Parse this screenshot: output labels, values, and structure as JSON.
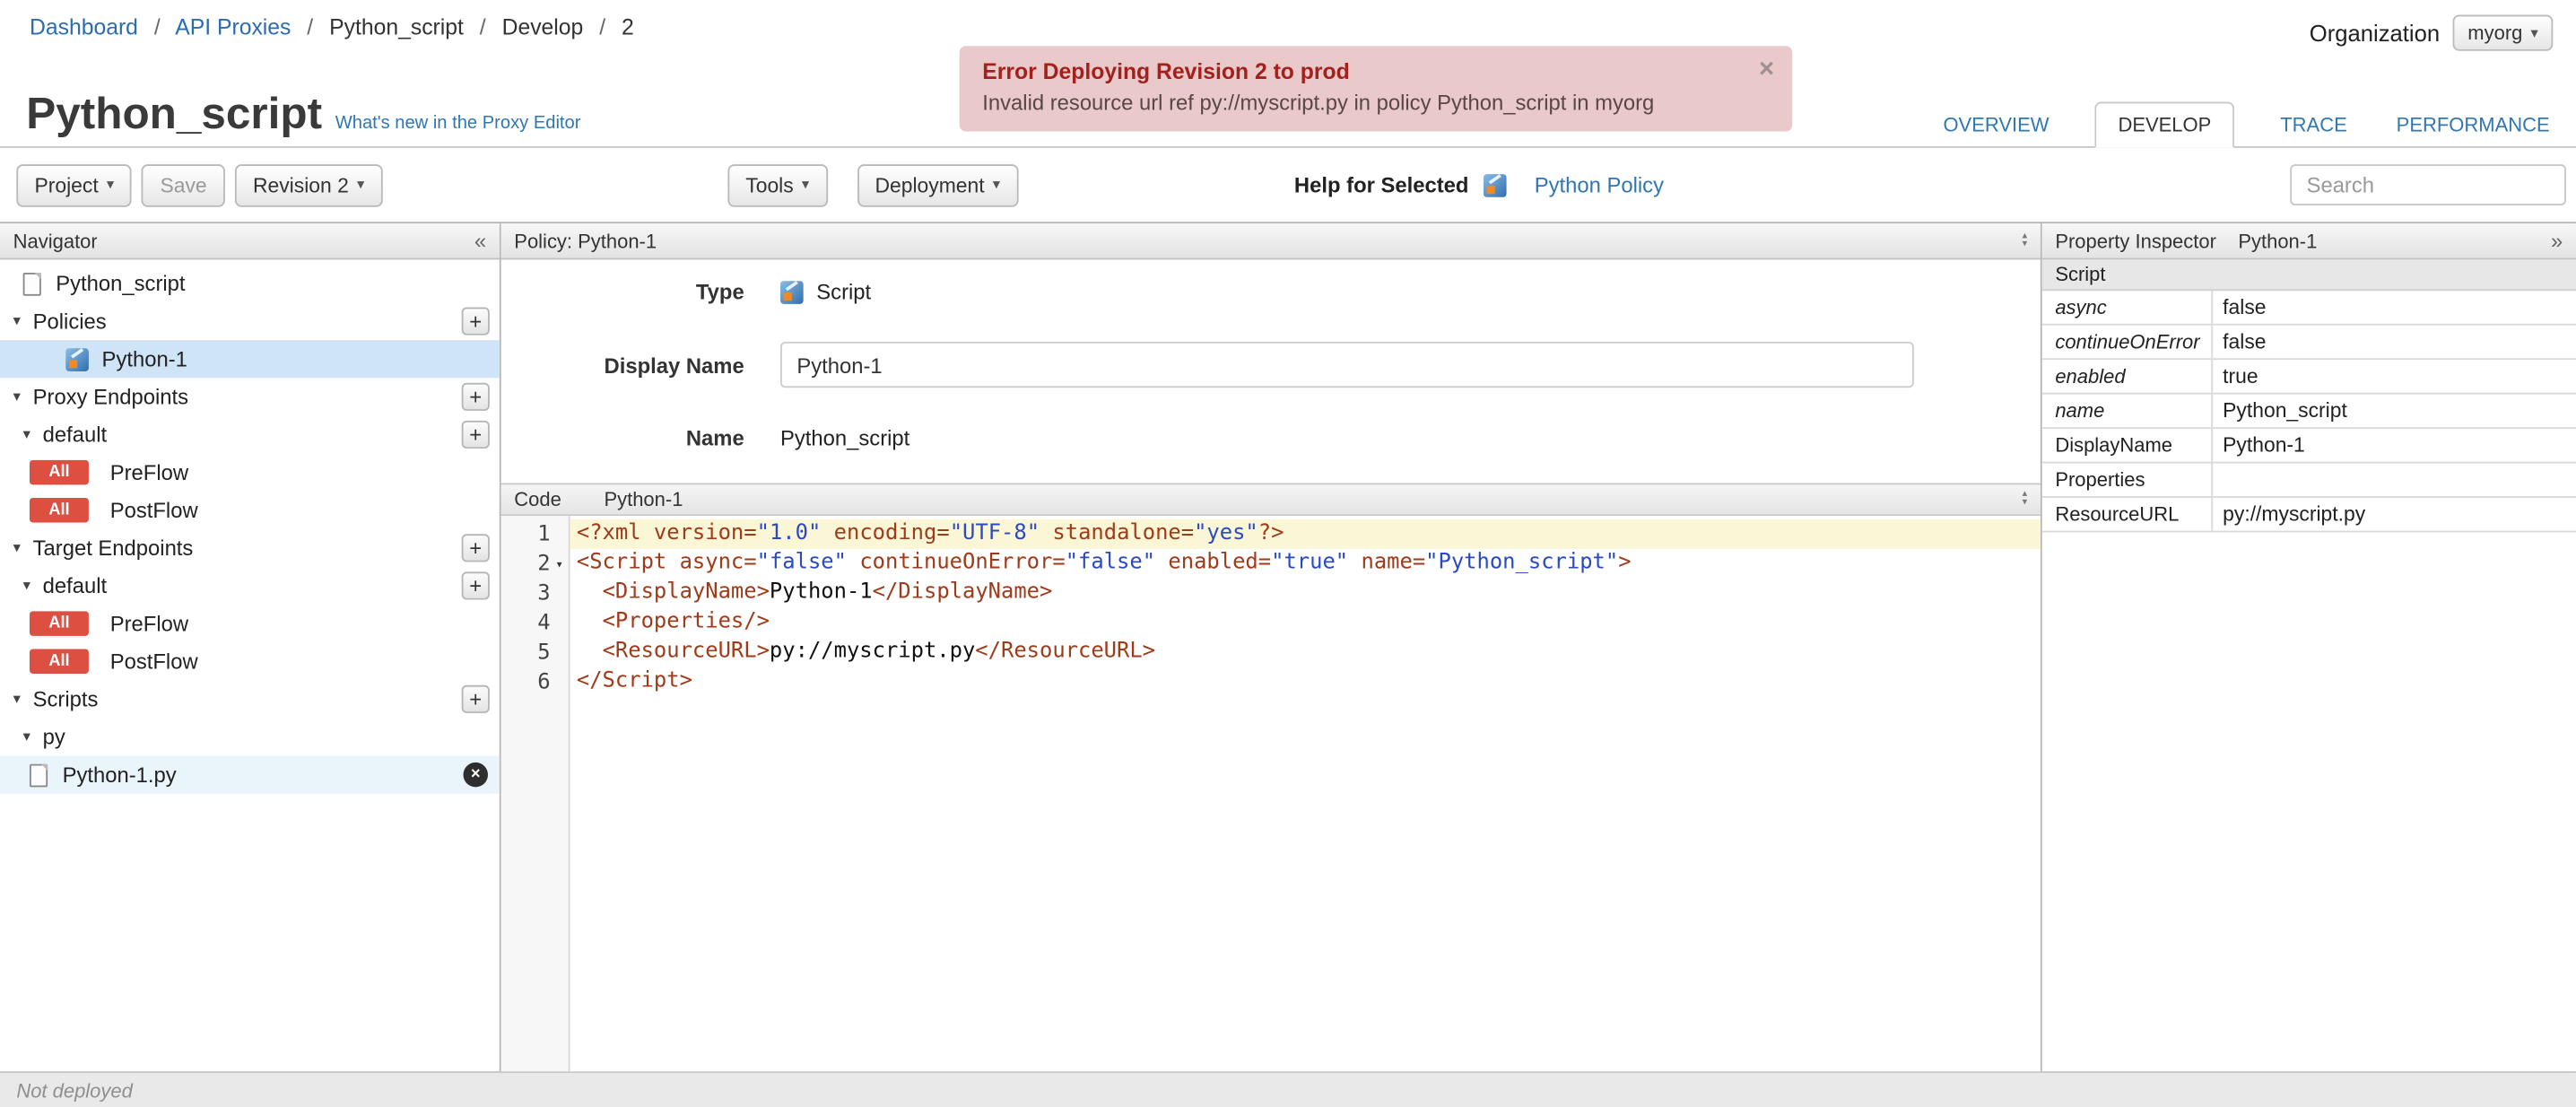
{
  "icons": {
    "caret_down": "▾",
    "collapse_left": "«",
    "expand_right": "»",
    "close": "×",
    "plus": "+",
    "tree_expanded": "▾",
    "sort_up": "▴",
    "sort_down": "▾",
    "fold_down": "▾",
    "delete_x": "×"
  },
  "colors": {
    "accent_blue": "#3077b4",
    "error_bg": "#e9c9c9",
    "error_title": "#a3201d",
    "badge_red": "#dc4f41",
    "selection_blue": "#cfe4f6",
    "active_line_yellow": "#fbf6d5"
  },
  "breadcrumb": {
    "separator": "/",
    "items": [
      {
        "label": "Dashboard",
        "link": true
      },
      {
        "label": "API Proxies",
        "link": true
      },
      {
        "label": "Python_script",
        "link": false
      },
      {
        "label": "Develop",
        "link": false
      },
      {
        "label": "2",
        "link": false
      }
    ]
  },
  "organization": {
    "label": "Organization",
    "value": "myorg"
  },
  "alert": {
    "title": "Error Deploying Revision 2 to prod",
    "message": "Invalid resource url ref py://myscript.py in policy Python_script in myorg"
  },
  "page": {
    "title": "Python_script",
    "whats_new_link": "What's new in the Proxy Editor"
  },
  "tabs": [
    {
      "label": "OVERVIEW"
    },
    {
      "label": "DEVELOP"
    },
    {
      "label": "TRACE"
    },
    {
      "label": "PERFORMANCE"
    }
  ],
  "toolbar": {
    "project": "Project",
    "save": "Save",
    "revision": "Revision 2",
    "tools": "Tools",
    "deployment": "Deployment",
    "help_label": "Help for Selected",
    "help_link": "Python Policy",
    "search_placeholder": "Search"
  },
  "navigator": {
    "title": "Navigator",
    "root": {
      "label": "Python_script"
    },
    "sections": {
      "policies": {
        "label": "Policies",
        "items": [
          {
            "label": "Python-1",
            "selected": true
          }
        ]
      },
      "proxy_endpoints": {
        "label": "Proxy Endpoints",
        "groups": [
          {
            "label": "default",
            "flows": [
              {
                "badge": "All",
                "label": "PreFlow"
              },
              {
                "badge": "All",
                "label": "PostFlow"
              }
            ]
          }
        ]
      },
      "target_endpoints": {
        "label": "Target Endpoints",
        "groups": [
          {
            "label": "default",
            "flows": [
              {
                "badge": "All",
                "label": "PreFlow"
              },
              {
                "badge": "All",
                "label": "PostFlow"
              }
            ]
          }
        ]
      },
      "scripts": {
        "label": "Scripts",
        "groups": [
          {
            "label": "py",
            "files": [
              {
                "label": "Python-1.py"
              }
            ]
          }
        ]
      }
    }
  },
  "policy_panel": {
    "title": "Policy: Python-1",
    "type_label": "Type",
    "type_value": "Script",
    "display_name_label": "Display Name",
    "display_name_value": "Python-1",
    "name_label": "Name",
    "name_value": "Python_script"
  },
  "code_panel": {
    "label": "Code",
    "name": "Python-1",
    "lines": [
      {
        "n": 1,
        "active": true,
        "fold": false,
        "tokens": [
          [
            "tag",
            "<?xml "
          ],
          [
            "attr",
            "version="
          ],
          [
            "val",
            "\"1.0\""
          ],
          [
            "pln",
            " "
          ],
          [
            "attr",
            "encoding="
          ],
          [
            "val",
            "\"UTF-8\""
          ],
          [
            "pln",
            " "
          ],
          [
            "attr",
            "standalone="
          ],
          [
            "val",
            "\"yes\""
          ],
          [
            "tag",
            "?>"
          ]
        ]
      },
      {
        "n": 2,
        "active": false,
        "fold": true,
        "tokens": [
          [
            "tag",
            "<Script "
          ],
          [
            "attr",
            "async="
          ],
          [
            "val",
            "\"false\""
          ],
          [
            "pln",
            " "
          ],
          [
            "attr",
            "continueOnError="
          ],
          [
            "val",
            "\"false\""
          ],
          [
            "pln",
            " "
          ],
          [
            "attr",
            "enabled="
          ],
          [
            "val",
            "\"true\""
          ],
          [
            "pln",
            " "
          ],
          [
            "attr",
            "name="
          ],
          [
            "val",
            "\"Python_script\""
          ],
          [
            "tag",
            ">"
          ]
        ]
      },
      {
        "n": 3,
        "active": false,
        "fold": false,
        "tokens": [
          [
            "pln",
            "  "
          ],
          [
            "tag",
            "<DisplayName>"
          ],
          [
            "txt",
            "Python-1"
          ],
          [
            "tag",
            "</DisplayName>"
          ]
        ]
      },
      {
        "n": 4,
        "active": false,
        "fold": false,
        "tokens": [
          [
            "pln",
            "  "
          ],
          [
            "tag",
            "<Properties/>"
          ]
        ]
      },
      {
        "n": 5,
        "active": false,
        "fold": false,
        "tokens": [
          [
            "pln",
            "  "
          ],
          [
            "tag",
            "<ResourceURL>"
          ],
          [
            "txt",
            "py://myscript.py"
          ],
          [
            "tag",
            "</ResourceURL>"
          ]
        ]
      },
      {
        "n": 6,
        "active": false,
        "fold": false,
        "tokens": [
          [
            "tag",
            "</Script>"
          ]
        ]
      }
    ]
  },
  "property_inspector": {
    "title": "Property Inspector",
    "policy_name": "Python-1",
    "section_label": "Script",
    "rows": [
      {
        "key": "async",
        "value": "false",
        "italic": true
      },
      {
        "key": "continueOnError",
        "value": "false",
        "italic": true
      },
      {
        "key": "enabled",
        "value": "true",
        "italic": true
      },
      {
        "key": "name",
        "value": "Python_script",
        "italic": true
      },
      {
        "key": "DisplayName",
        "value": "Python-1",
        "italic": false
      },
      {
        "key": "Properties",
        "value": "",
        "italic": false
      },
      {
        "key": "ResourceURL",
        "value": "py://myscript.py",
        "italic": false
      }
    ]
  },
  "status_bar": {
    "text": "Not deployed"
  }
}
